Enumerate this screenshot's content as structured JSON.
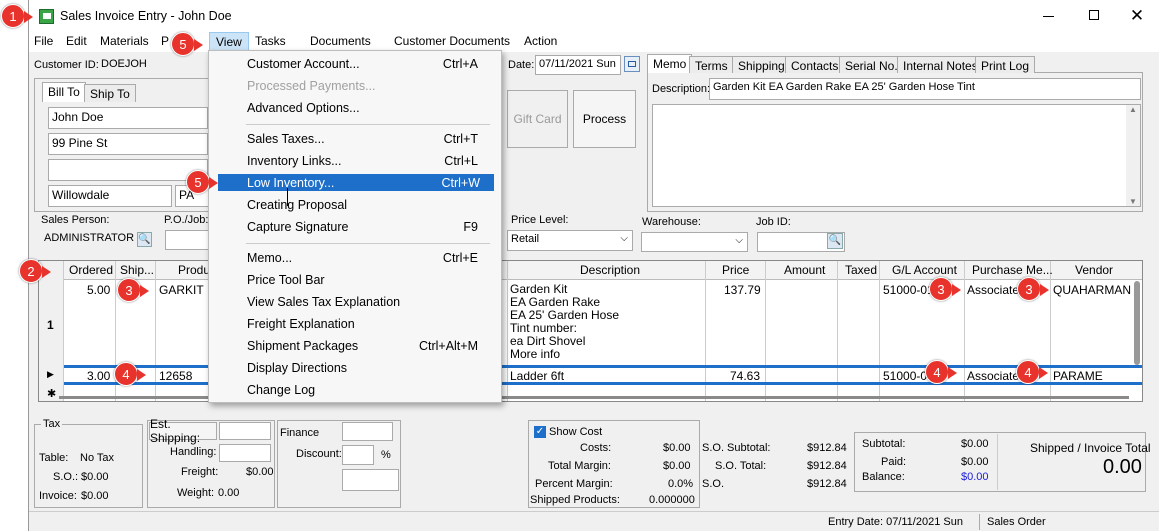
{
  "window": {
    "title": "Sales Invoice Entry - John Doe"
  },
  "menubar": [
    "File",
    "Edit",
    "Materials",
    "P",
    "View",
    "Tasks",
    "Documents",
    "Customer Documents",
    "Action"
  ],
  "customer": {
    "id_label": "Customer ID:",
    "id_value": "DOEJOH",
    "date_label": "Date:",
    "date_value": "07/11/2021 Sun"
  },
  "address_tabs": [
    "Bill To",
    "Ship To"
  ],
  "address": {
    "name": "John Doe",
    "street": "99 Pine St",
    "line2": "",
    "city": "Willowdale",
    "state": "PA"
  },
  "buttons": {
    "gift_card": "Gift Card",
    "process": "Process"
  },
  "right_tabs": [
    "Memo",
    "Terms",
    "Shipping",
    "Contacts",
    "Serial No.",
    "Internal Notes",
    "Print Log"
  ],
  "memo": {
    "desc_label": "Description:",
    "desc_value": "Garden Kit EA Garden Rake EA 25' Garden Hose Tint"
  },
  "fields": {
    "sales_person_label": "Sales Person:",
    "sales_person": "ADMINISTRATOR",
    "po_label": "P.O./Job:",
    "price_level_label": "Price Level:",
    "price_level": "Retail",
    "warehouse_label": "Warehouse:",
    "job_id_label": "Job ID:"
  },
  "grid": {
    "headers": [
      "Ordered",
      "Ship...",
      "Produc",
      "Description",
      "Price",
      "Amount",
      "Taxed",
      "G/L Account",
      "Purchase Me...",
      "Vendor"
    ],
    "rows": [
      {
        "num": "1",
        "ordered": "5.00",
        "product": "GARKIT",
        "desc": [
          "Garden Kit",
          "EA Garden Rake",
          "EA 25' Garden Hose",
          "Tint number:",
          "ea Dirt Shovel",
          "More info"
        ],
        "price": "137.79",
        "gl": "51000-01",
        "purchase": "Associated",
        "vendor": "QUAHARMAN"
      },
      {
        "num": "",
        "ordered": "3.00",
        "product": "12658",
        "desc": [
          "Ladder 6ft"
        ],
        "price": "74.63",
        "gl": "51000-0",
        "purchase": "Associated",
        "vendor": "PARAME"
      }
    ]
  },
  "view_menu": [
    {
      "label": "Customer Account...",
      "shortcut": "Ctrl+A",
      "disabled": false
    },
    {
      "label": "Processed Payments...",
      "shortcut": "",
      "disabled": true
    },
    {
      "label": "Advanced Options...",
      "shortcut": "",
      "disabled": false
    },
    {
      "label": "Sales Taxes...",
      "shortcut": "Ctrl+T",
      "disabled": false
    },
    {
      "label": "Inventory Links...",
      "shortcut": "Ctrl+L",
      "disabled": false
    },
    {
      "label": "Low Inventory...",
      "shortcut": "Ctrl+W",
      "disabled": false
    },
    {
      "label": "Creating Proposal",
      "shortcut": "",
      "disabled": false
    },
    {
      "label": "Capture Signature",
      "shortcut": "F9",
      "disabled": false
    },
    {
      "label": "Memo...",
      "shortcut": "Ctrl+E",
      "disabled": false
    },
    {
      "label": "Price Tool Bar",
      "shortcut": "",
      "disabled": false
    },
    {
      "label": "View Sales Tax Explanation",
      "shortcut": "",
      "disabled": false
    },
    {
      "label": "Freight Explanation",
      "shortcut": "",
      "disabled": false
    },
    {
      "label": "Shipment Packages",
      "shortcut": "Ctrl+Alt+M",
      "disabled": false
    },
    {
      "label": "Display Directions",
      "shortcut": "",
      "disabled": false
    },
    {
      "label": "Change Log",
      "shortcut": "",
      "disabled": false
    }
  ],
  "tax": {
    "title": "Tax",
    "table_label": "Table:",
    "table_value": "No Tax",
    "so_label": "S.O.:",
    "so_value": "$0.00",
    "invoice_label": "Invoice:",
    "invoice_value": "$0.00"
  },
  "shipping": {
    "est_label": "Est. Shipping:",
    "handling_label": "Handling:",
    "freight_label": "Freight:",
    "freight_value": "$0.00",
    "weight_label": "Weight:",
    "weight_value": "0.00"
  },
  "finance": {
    "finance_label": "Finance",
    "discount_label": "Discount:",
    "pct": "%"
  },
  "cost": {
    "show_cost": "Show Cost",
    "costs_label": "Costs:",
    "costs": "$0.00",
    "margin_label": "Total Margin:",
    "margin": "$0.00",
    "pct_label": "Percent Margin:",
    "pct": "0.0%",
    "shipped_label": "Shipped Products:",
    "shipped": "0.000000"
  },
  "so": {
    "subtotal_label": "S.O. Subtotal:",
    "subtotal": "$912.84",
    "total_label": "S.O. Total:",
    "total": "$912.84",
    "so_label": "S.O.",
    "so_value": "$912.84"
  },
  "totals": {
    "subtotal_label": "Subtotal:",
    "subtotal": "$0.00",
    "paid_label": "Paid:",
    "paid": "$0.00",
    "balance_label": "Balance:",
    "balance": "$0.00",
    "shipped_label": "Shipped / Invoice Total",
    "shipped_value": "0.00"
  },
  "status": {
    "entry_date": "Entry Date: 07/11/2021 Sun",
    "type": "Sales Order"
  },
  "badges": [
    "1",
    "2",
    "3",
    "3",
    "3",
    "4",
    "4",
    "4",
    "5",
    "5"
  ],
  "colors": {
    "highlight": "#1e6fc9",
    "badge": "#e8322c",
    "balance": "#1a1adc"
  }
}
